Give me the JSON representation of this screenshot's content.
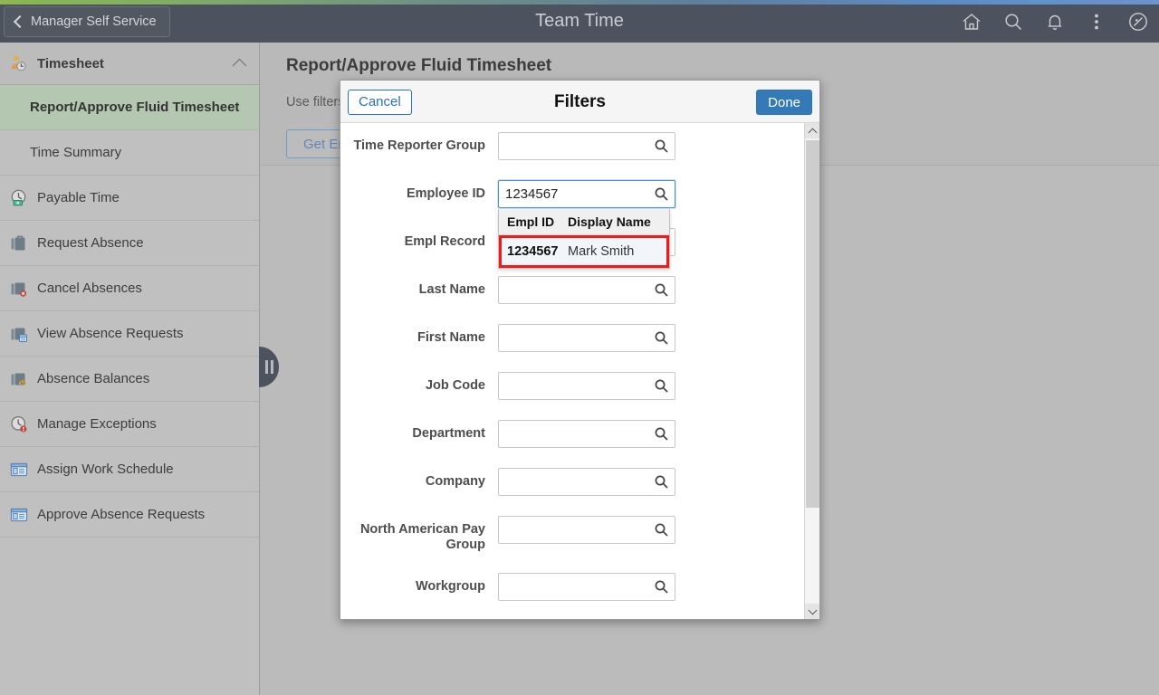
{
  "header": {
    "back_label": "Manager Self Service",
    "title": "Team Time",
    "icons": [
      {
        "name": "home-icon",
        "label": "Home"
      },
      {
        "name": "search-icon",
        "label": "Search"
      },
      {
        "name": "notifications-bell-icon",
        "label": "Notifications"
      },
      {
        "name": "actions-menu-icon",
        "label": "Actions"
      },
      {
        "name": "navbar-compass-icon",
        "label": "NavBar"
      }
    ]
  },
  "sidebar": {
    "group_title": "Timesheet",
    "group_icon": "person-clock-icon",
    "collapse_icon": "chevron-up-icon",
    "items": [
      {
        "label": "Report/Approve Fluid Timesheet",
        "icon": "none",
        "active": true
      },
      {
        "label": "Time Summary",
        "icon": "none",
        "active": false
      },
      {
        "label": "Payable Time",
        "icon": "clock-money-icon",
        "active": false
      },
      {
        "label": "Request Absence",
        "icon": "briefcase-icon",
        "active": false
      },
      {
        "label": "Cancel Absences",
        "icon": "briefcase-cancel-icon",
        "active": false
      },
      {
        "label": "View Absence Requests",
        "icon": "briefcase-calendar-icon",
        "active": false
      },
      {
        "label": "Absence Balances",
        "icon": "briefcase-balance-icon",
        "active": false
      },
      {
        "label": "Manage Exceptions",
        "icon": "clock-alert-icon",
        "active": false
      },
      {
        "label": "Assign Work Schedule",
        "icon": "window-panel-icon",
        "active": false
      },
      {
        "label": "Approve Absence Requests",
        "icon": "window-panel-icon",
        "active": false
      }
    ],
    "handle_name": "sidebar-collapse-handle"
  },
  "main": {
    "page_title": "Report/Approve Fluid Timesheet",
    "instruction": "Use filters to change the search criteria or Get Employees to apply Search Options.",
    "get_employees_label": "Get Employees"
  },
  "modal": {
    "title": "Filters",
    "cancel_label": "Cancel",
    "done_label": "Done",
    "fields": [
      {
        "label": "Time Reporter Group",
        "value": "",
        "name": "time-reporter-group"
      },
      {
        "label": "Employee ID",
        "value": "1234567",
        "name": "employee-id"
      },
      {
        "label": "Empl Record",
        "value": "",
        "name": "empl-record"
      },
      {
        "label": "Last Name",
        "value": "",
        "name": "last-name"
      },
      {
        "label": "First Name",
        "value": "",
        "name": "first-name"
      },
      {
        "label": "Job Code",
        "value": "",
        "name": "job-code"
      },
      {
        "label": "Department",
        "value": "",
        "name": "department"
      },
      {
        "label": "Company",
        "value": "",
        "name": "company"
      },
      {
        "label": "North American Pay Group",
        "value": "",
        "name": "north-american-pay-group"
      },
      {
        "label": "Workgroup",
        "value": "",
        "name": "workgroup"
      }
    ],
    "autocomplete": {
      "col_id": "Empl ID",
      "col_name": "Display Name",
      "rows": [
        {
          "id": "1234567",
          "name": "Mark Smith",
          "highlighted": true
        }
      ]
    }
  },
  "colors": {
    "header_bg": "#4c525e",
    "sidebar_bg": "#c0c0c0",
    "active_item_bg": "#b4c7b1",
    "accent_blue": "#337ab7",
    "highlight_red": "#ee1b1b",
    "content_bg": "#b9b9b9"
  }
}
